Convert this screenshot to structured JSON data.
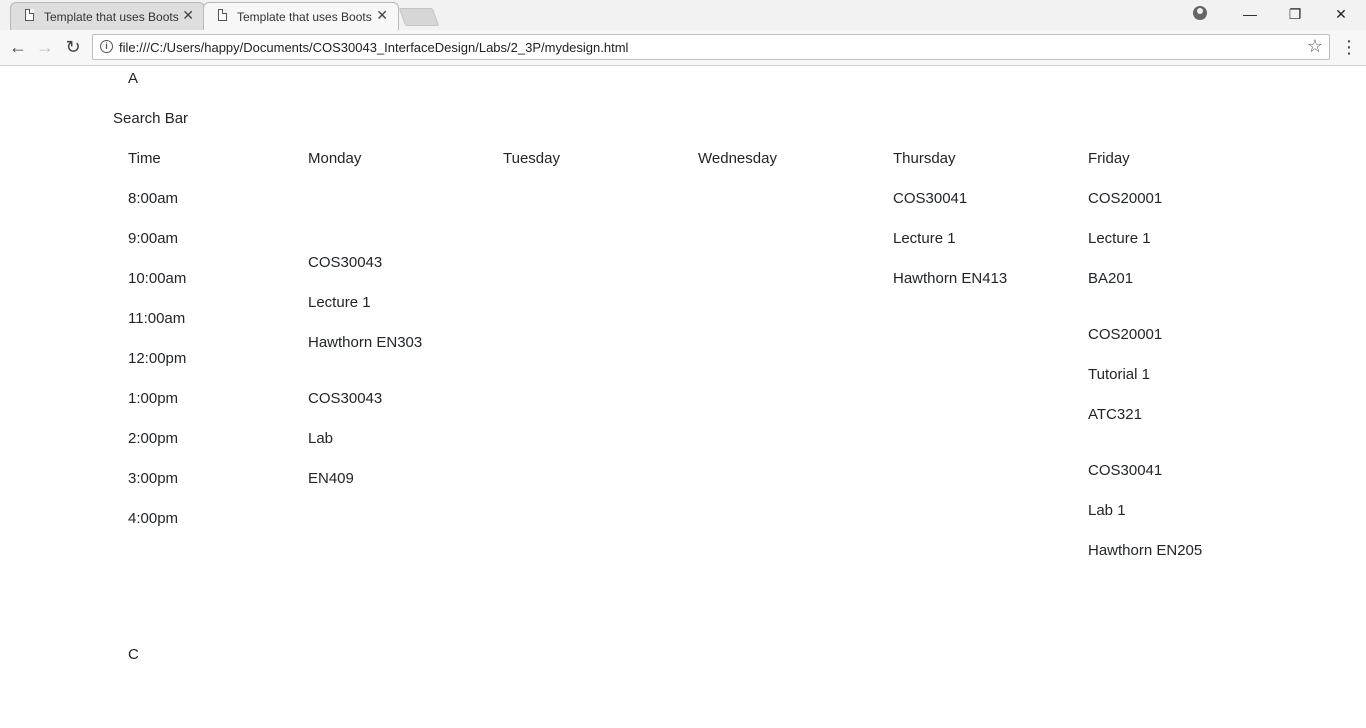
{
  "browser": {
    "tabs": [
      {
        "title": "Template that uses Boots",
        "close": "✕"
      },
      {
        "title": "Template that uses Boots",
        "close": "✕"
      }
    ],
    "url": "file:///C:/Users/happy/Documents/COS30043_InterfaceDesign/Labs/2_3P/mydesign.html",
    "window_controls": {
      "minimize": "—",
      "restore": "❐",
      "close": "✕"
    }
  },
  "page": {
    "header_letter": "A",
    "search_label": "Search Bar",
    "footer_letter": "C",
    "columns": {
      "time": "Time",
      "monday": "Monday",
      "tuesday": "Tuesday",
      "wednesday": "Wednesday",
      "thursday": "Thursday",
      "friday": "Friday"
    },
    "times": [
      "8:00am",
      "9:00am",
      "10:00am",
      "11:00am",
      "12:00pm",
      "1:00pm",
      "2:00pm",
      "3:00pm",
      "4:00pm"
    ],
    "monday": [
      {
        "code": "COS30043",
        "type": "Lecture 1",
        "room": "Hawthorn EN303"
      },
      {
        "code": "COS30043",
        "type": "Lab",
        "room": "EN409"
      }
    ],
    "thursday": [
      {
        "code": "COS30041",
        "type": "Lecture 1",
        "room": "Hawthorn EN413"
      }
    ],
    "friday": [
      {
        "code": "COS20001",
        "type": "Lecture 1",
        "room": "BA201"
      },
      {
        "code": "COS20001",
        "type": "Tutorial 1",
        "room": "ATC321"
      },
      {
        "code": "COS30041",
        "type": "Lab 1",
        "room": "Hawthorn EN205"
      }
    ]
  }
}
